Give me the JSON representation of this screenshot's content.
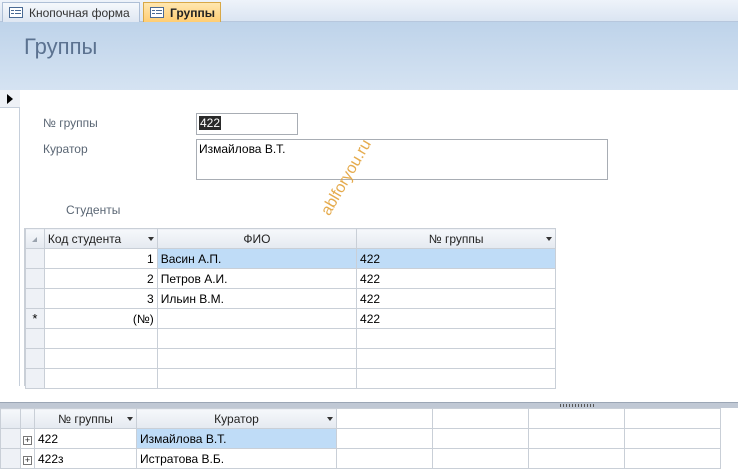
{
  "tabs": [
    {
      "label": "Кнопочная форма",
      "active": false
    },
    {
      "label": "Группы",
      "active": true
    }
  ],
  "form": {
    "title": "Группы",
    "fields": {
      "group_num_label": "№ группы",
      "group_num_value": "422",
      "curator_label": "Куратор",
      "curator_value": "Измайлова В.Т."
    },
    "students_label": "Студенты"
  },
  "watermark": "ablforyou.ru",
  "subform": {
    "columns": [
      "Код студента",
      "ФИО",
      "№ группы"
    ],
    "rows": [
      {
        "id": "1",
        "name": "Васин А.П.",
        "group": "422"
      },
      {
        "id": "2",
        "name": "Петров А.И.",
        "group": "422"
      },
      {
        "id": "3",
        "name": "Ильин В.М.",
        "group": "422"
      }
    ],
    "new_row": {
      "marker": "*",
      "id": "(№)",
      "name": "",
      "group": "422"
    }
  },
  "bottom_sheet": {
    "columns": [
      "№ группы",
      "Куратор"
    ],
    "rows": [
      {
        "group": "422",
        "curator": "Измайлова В.Т."
      },
      {
        "group": "422з",
        "curator": "Истратова В.Б."
      }
    ]
  },
  "colors": {
    "accent": "#ffcd73",
    "header": "#c8daee",
    "selection": "#bfdcf7"
  }
}
